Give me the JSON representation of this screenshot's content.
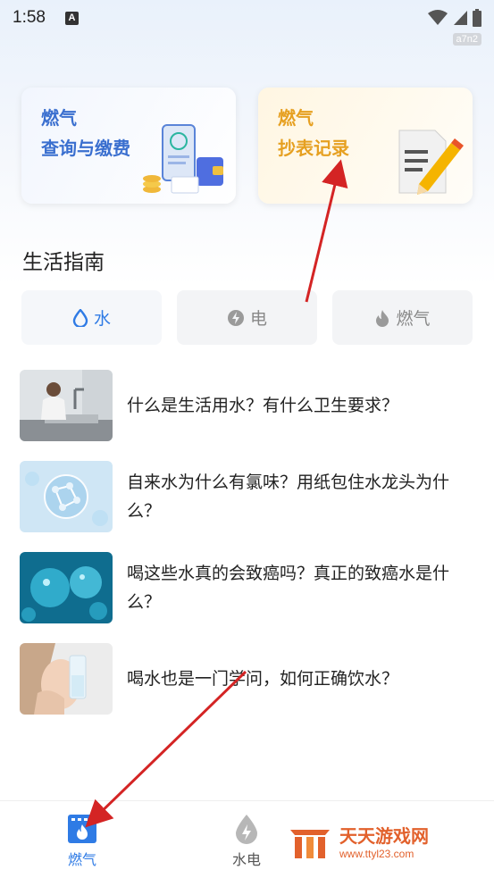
{
  "status": {
    "time": "1:58",
    "notif_letter": "A",
    "badge": "a7n2"
  },
  "cards": [
    {
      "line1": "燃气",
      "line2": "查询与缴费"
    },
    {
      "line1": "燃气",
      "line2": "抄表记录"
    }
  ],
  "section_title": "生活指南",
  "tabs": [
    {
      "label": "水",
      "icon": "water-drop-icon",
      "active": true
    },
    {
      "label": "电",
      "icon": "lightning-icon",
      "active": false
    },
    {
      "label": "燃气",
      "icon": "flame-icon",
      "active": false
    }
  ],
  "articles": [
    {
      "title": "什么是生活用水？有什么卫生要求？"
    },
    {
      "title": "自来水为什么有氯味？用纸包住水龙头为什么？"
    },
    {
      "title": "喝这些水真的会致癌吗？真正的致癌水是什么？"
    },
    {
      "title": "喝水也是一门学问，如何正确饮水？"
    }
  ],
  "bottom_nav": [
    {
      "label": "燃气",
      "icon": "gas-stove-icon",
      "active": true
    },
    {
      "label": "水电",
      "icon": "water-lightning-icon",
      "active": false
    }
  ],
  "watermark": {
    "title": "天天游戏网",
    "url": "www.ttyl23.com"
  },
  "colors": {
    "accent": "#2f7be5",
    "gas_orange": "#e6a021",
    "card_blue": "#3a6fcf",
    "arrow_red": "#d42424"
  }
}
